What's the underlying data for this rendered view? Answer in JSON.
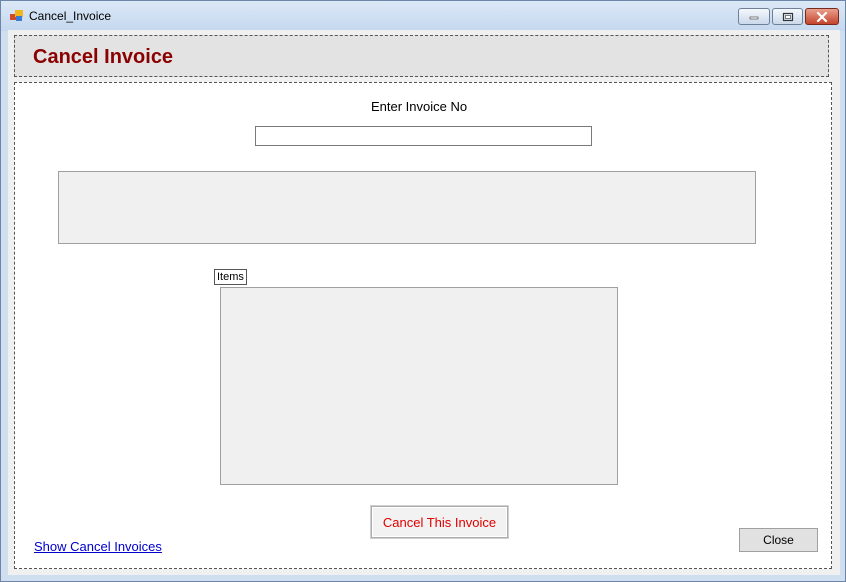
{
  "window": {
    "title": "Cancel_Invoice",
    "icon": "app-window-icon",
    "controls": [
      "minimize-icon",
      "maximize-icon",
      "close-icon"
    ]
  },
  "header": {
    "title": "Cancel Invoice",
    "title_color": "#8b0000"
  },
  "form": {
    "invoice_label": "Enter Invoice No",
    "invoice_value": "",
    "items_label": "Items",
    "cancel_button_label": "Cancel This Invoice",
    "cancel_button_color": "#e00000",
    "show_link_label": "Show Cancel Invoices",
    "close_button_label": "Close"
  }
}
